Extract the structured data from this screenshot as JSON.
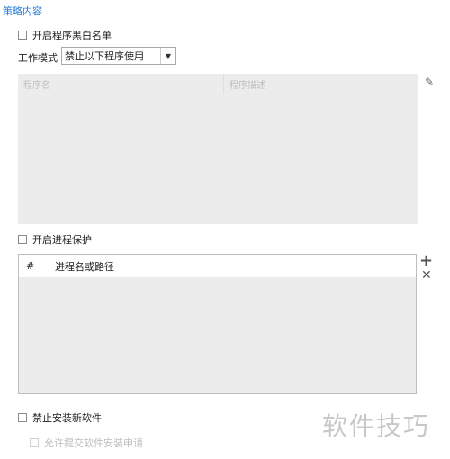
{
  "section": {
    "title": "策略内容"
  },
  "whitelist_checkbox": {
    "label": "开启程序黑白名单"
  },
  "work_mode": {
    "label": "工作模式",
    "selected": "禁止以下程序使用"
  },
  "program_table": {
    "columns": [
      "程序名",
      "程序描述"
    ]
  },
  "process_protection": {
    "label": "开启进程保护"
  },
  "process_table": {
    "columns": [
      "#",
      "进程名或路径"
    ]
  },
  "ban_install": {
    "label": "禁止安装新软件"
  },
  "allow_request": {
    "label": "允许提交软件安装申请"
  },
  "watermark": {
    "text": "软件技巧"
  },
  "icons": {
    "edit": "pencil-icon",
    "add": "plus-icon",
    "remove": "close-icon",
    "dropdown": "chevron-down-icon"
  }
}
